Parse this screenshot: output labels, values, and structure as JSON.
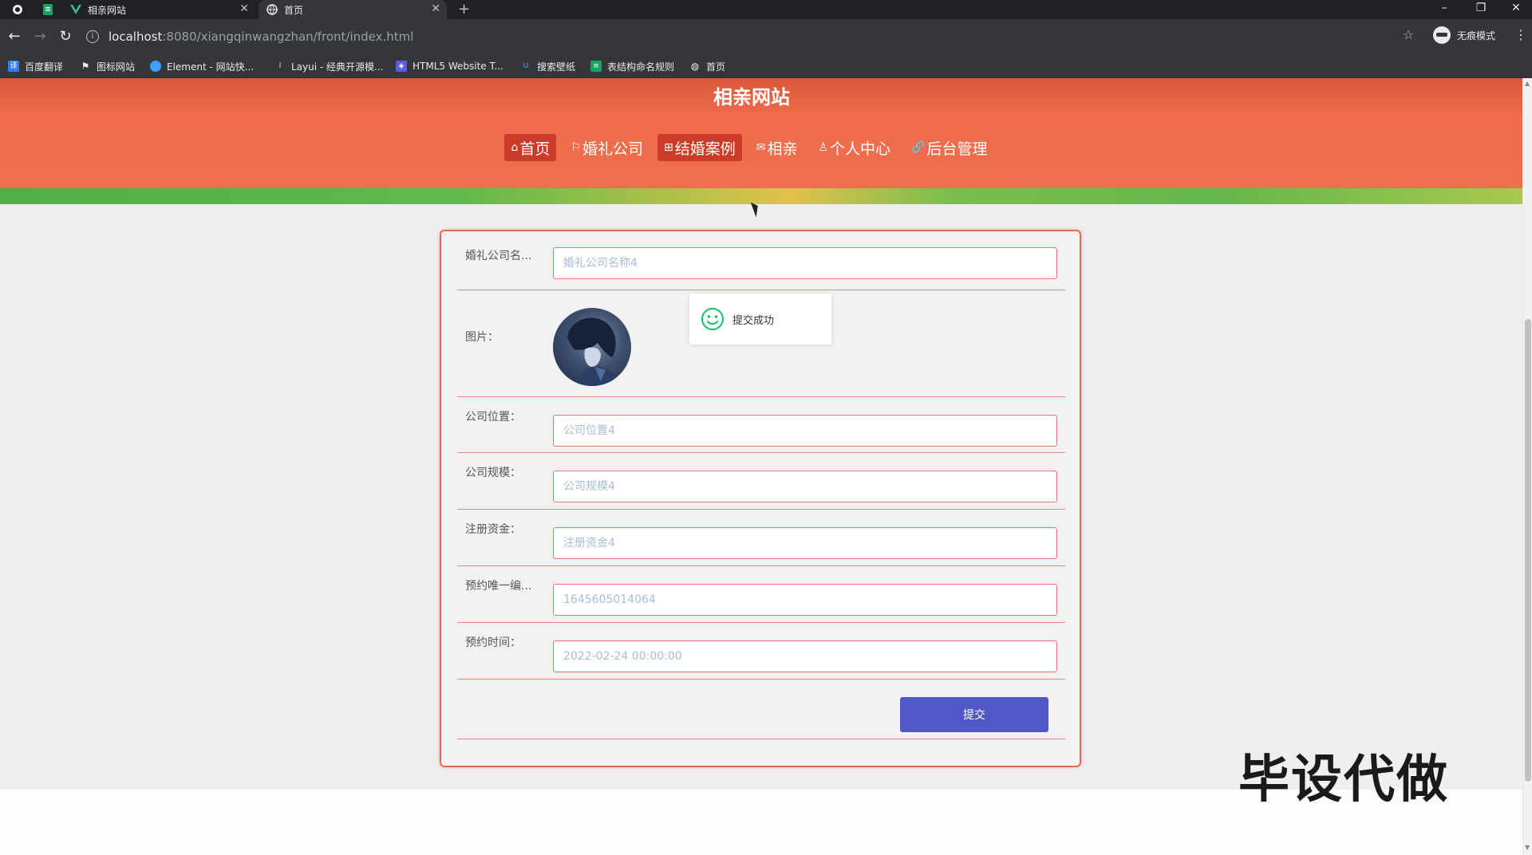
{
  "browser": {
    "tabs": [
      {
        "title": "相亲网站",
        "active": false
      },
      {
        "title": "首页",
        "active": true
      }
    ],
    "new_tab": "+",
    "address": {
      "host": "localhost",
      "path": ":8080/xiangqinwangzhan/front/index.html"
    },
    "profile_label": "无痕模式",
    "bookmarks": [
      "百度翻译",
      "图标网站",
      "Element - 网站快...",
      "Layui - 经典开源模...",
      "HTML5 Website T...",
      "搜索壁纸",
      "表结构命名规则",
      "首页"
    ]
  },
  "site": {
    "title": "相亲网站",
    "nav": [
      {
        "icon": "home-icon",
        "glyph": "⌂",
        "label": "首页",
        "active": true
      },
      {
        "icon": "flag-icon",
        "glyph": "⚐",
        "label": "婚礼公司",
        "active": false
      },
      {
        "icon": "grid-icon",
        "glyph": "⊞",
        "label": "结婚案例",
        "active": true
      },
      {
        "icon": "mail-icon",
        "glyph": "✉",
        "label": "相亲",
        "active": false
      },
      {
        "icon": "user-icon",
        "glyph": "♙",
        "label": "个人中心",
        "active": false
      },
      {
        "icon": "link-icon",
        "glyph": "🔗",
        "label": "后台管理",
        "active": false
      }
    ]
  },
  "form": {
    "fields": [
      {
        "label": "婚礼公司名...",
        "value": "婚礼公司名称4"
      },
      {
        "label": "图片：",
        "image": "avatar"
      },
      {
        "label": "公司位置：",
        "value": "公司位置4"
      },
      {
        "label": "公司规模：",
        "value": "公司规模4"
      },
      {
        "label": "注册资金：",
        "value": "注册资金4"
      },
      {
        "label": "预约唯一编...",
        "value": "1645605014064"
      },
      {
        "label": "预约时间：",
        "value": "2022-02-24 00:00:00"
      }
    ],
    "submit_label": "提交"
  },
  "toast": {
    "message": "提交成功"
  },
  "watermark": "毕设代做",
  "colors": {
    "header": "#ef6e4d",
    "nav_active": "#cc3b28",
    "card_border": "#e06a5a",
    "submit": "#5057c7",
    "toast_icon": "#19be6b"
  }
}
